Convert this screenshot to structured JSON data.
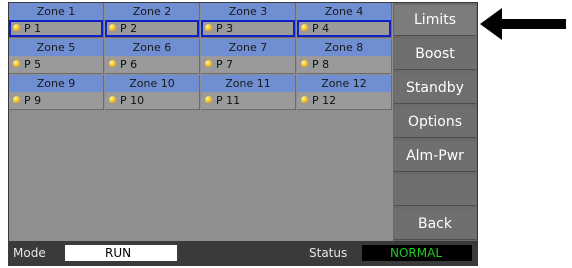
{
  "zones": [
    {
      "name": "Zone 1",
      "program": "P 1",
      "selected": true
    },
    {
      "name": "Zone 2",
      "program": "P 2",
      "selected": true
    },
    {
      "name": "Zone 3",
      "program": "P 3",
      "selected": true
    },
    {
      "name": "Zone 4",
      "program": "P 4",
      "selected": true
    },
    {
      "name": "Zone 5",
      "program": "P 5",
      "selected": false
    },
    {
      "name": "Zone 6",
      "program": "P 6",
      "selected": false
    },
    {
      "name": "Zone 7",
      "program": "P 7",
      "selected": false
    },
    {
      "name": "Zone 8",
      "program": "P 8",
      "selected": false
    },
    {
      "name": "Zone 9",
      "program": "P 9",
      "selected": false
    },
    {
      "name": "Zone 10",
      "program": "P 10",
      "selected": false
    },
    {
      "name": "Zone 11",
      "program": "P 11",
      "selected": false
    },
    {
      "name": "Zone 12",
      "program": "P 12",
      "selected": false
    }
  ],
  "menu": {
    "items": [
      "Limits",
      "Boost",
      "Standby",
      "Options",
      "Alm-Pwr",
      "",
      "Back"
    ],
    "active": "Limits"
  },
  "status_bar": {
    "mode_label": "Mode",
    "mode_value": "RUN",
    "status_label": "Status",
    "status_value": "NORMAL"
  },
  "colors": {
    "zone_header": "#6f8fd2",
    "selection_border": "#1020c8",
    "status_ok": "#22c922",
    "led": "#f2c21a"
  },
  "icons": {
    "zone_indicator": "led-indicator-icon",
    "pointer": "arrow-left-icon"
  }
}
